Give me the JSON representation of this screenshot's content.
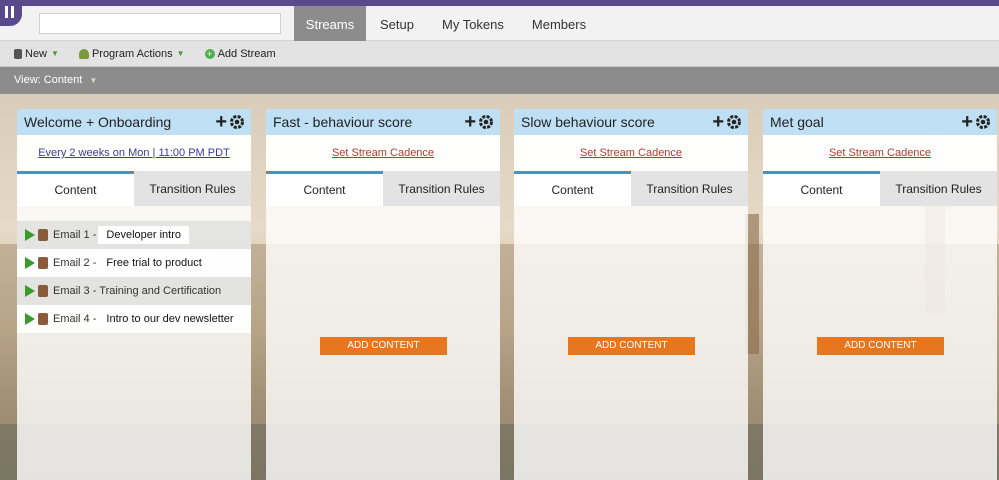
{
  "nav": {
    "search_value": "",
    "tabs": [
      {
        "label": "Streams",
        "active": true
      },
      {
        "label": "Setup",
        "active": false
      },
      {
        "label": "My Tokens",
        "active": false
      },
      {
        "label": "Members",
        "active": false
      }
    ]
  },
  "toolbar": {
    "new_label": "New",
    "program_actions_label": "Program Actions",
    "add_stream_label": "Add Stream"
  },
  "viewbar": {
    "label": "View: Content"
  },
  "colors": {
    "brand": "#5a4a8c",
    "header": "#bfe0f4",
    "accent_tab": "#4a90c2",
    "add_button": "#e8761e",
    "cadence_link": "#b33a2e"
  },
  "streams": [
    {
      "title": "Welcome + Onboarding",
      "cadence": "Every 2 weeks on Mon | 11:00 PM PDT",
      "tab_content": "Content",
      "tab_rules": "Transition Rules",
      "items": [
        {
          "label": "Email 1 -",
          "note": "Developer intro"
        },
        {
          "label": "Email 2 -",
          "note": "Free trial to product"
        },
        {
          "label": "Email 3 - Training and Certification",
          "note": ""
        },
        {
          "label": "Email 4 -",
          "note": "Intro to our dev newsletter"
        }
      ]
    },
    {
      "title": "Fast - behaviour score",
      "cadence": "Set Stream Cadence",
      "tab_content": "Content",
      "tab_rules": "Transition Rules",
      "add_label": "ADD CONTENT"
    },
    {
      "title": "Slow behaviour score",
      "cadence": "Set Stream Cadence",
      "tab_content": "Content",
      "tab_rules": "Transition Rules",
      "add_label": "ADD CONTENT"
    },
    {
      "title": "Met goal",
      "cadence": "Set Stream Cadence",
      "tab_content": "Content",
      "tab_rules": "Transition Rules",
      "add_label": "ADD CONTENT"
    }
  ]
}
